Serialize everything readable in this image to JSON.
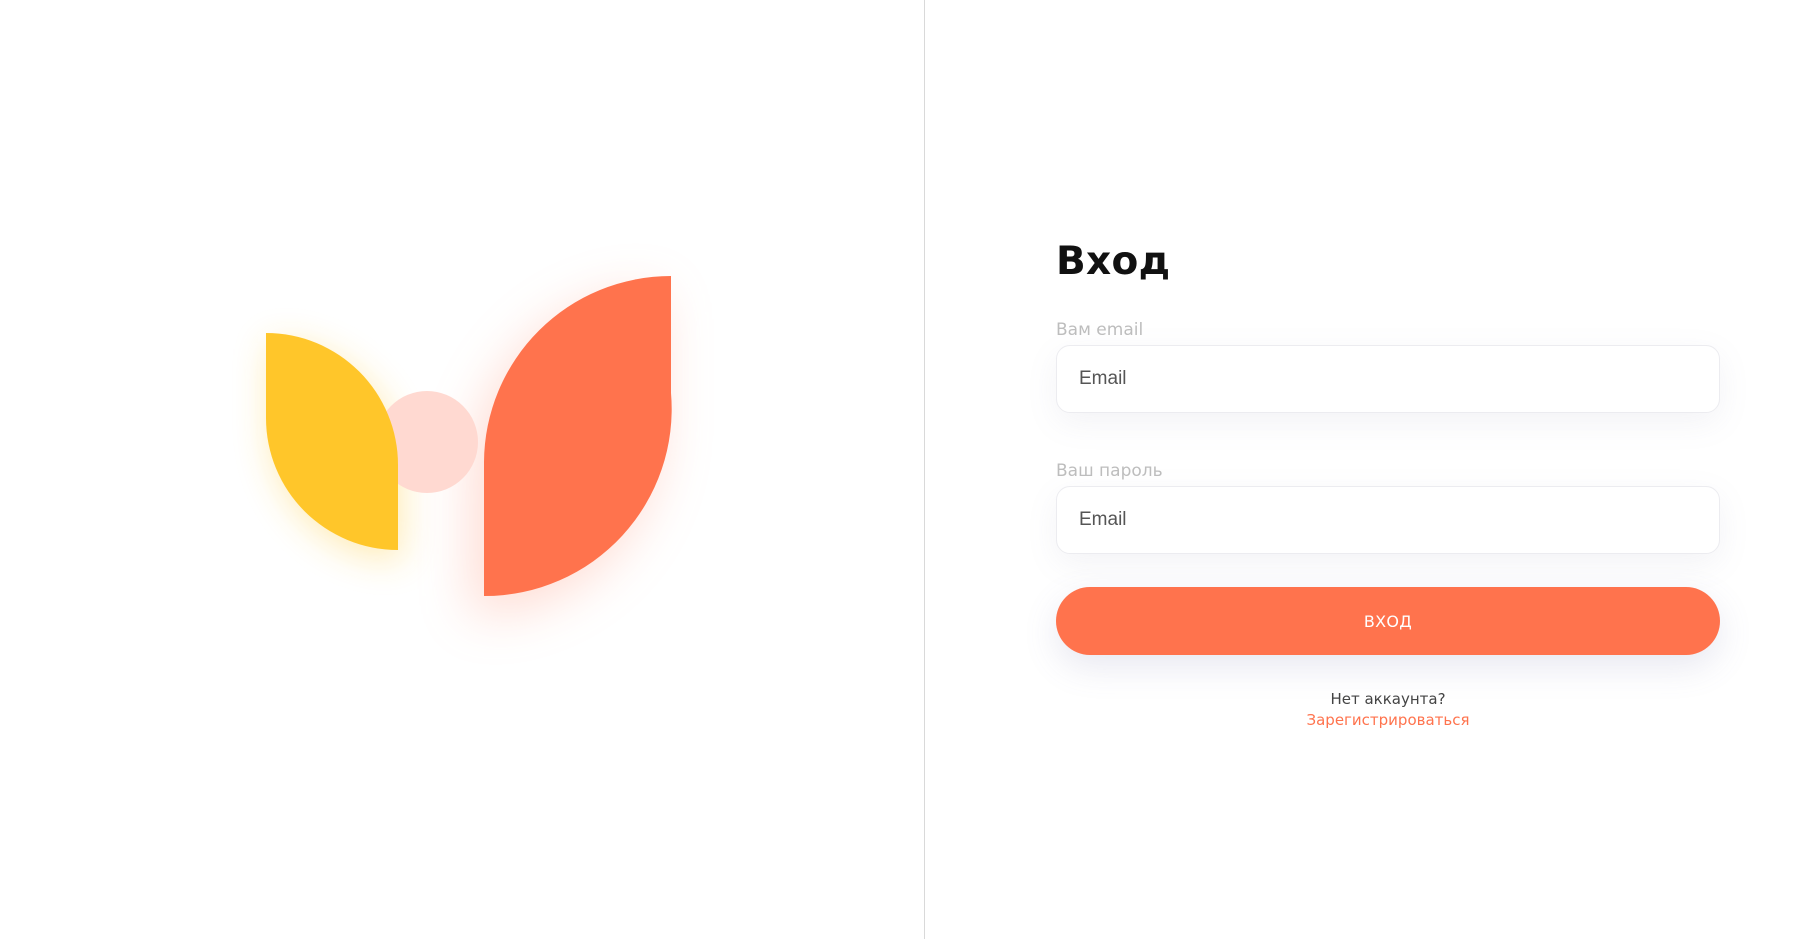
{
  "brand": {
    "logo_icon": "leaf-logo-icon",
    "colors": {
      "yellow": "#FFC62A",
      "orange": "#FF734D",
      "pink": "#FFD9D1"
    }
  },
  "login_form": {
    "title": "Вход",
    "email": {
      "label": "Вам email",
      "placeholder": "Email",
      "value": ""
    },
    "password": {
      "label": "Ваш пароль",
      "placeholder": "Email",
      "value": ""
    },
    "submit_label": "ВХОД",
    "no_account_text": "Нет аккаунта?",
    "register_link_label": "Зарегистрироваться"
  },
  "theme": {
    "accent": "#FF734D",
    "label_color": "#BDBDBD",
    "divider_color": "#D9D9D9"
  }
}
